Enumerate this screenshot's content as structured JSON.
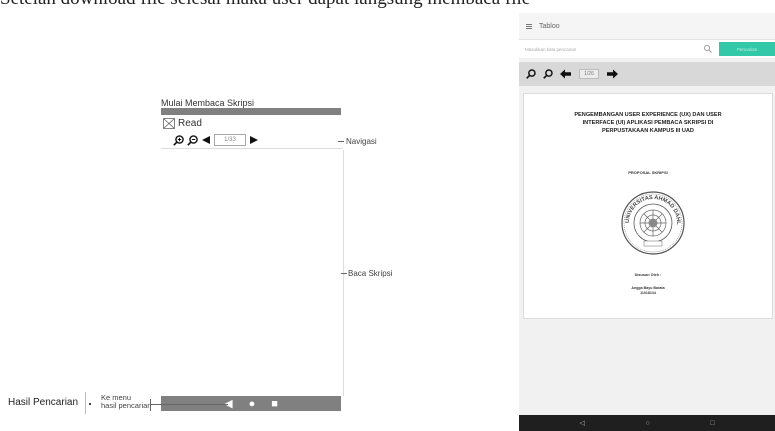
{
  "caption": {
    "text": "Setelah download file selesai maka user dapat langsung membaca file"
  },
  "wireframe": {
    "title": "Mulai Membaca Skripsi",
    "read_label": "Read",
    "page_indicator": "1/33",
    "nav_annotation": "Navigasi",
    "body_annotation": "Baca Skripsi",
    "bottom_nav": {
      "back": "◀",
      "home": "●",
      "recent": "■"
    }
  },
  "flow": {
    "left_label": "Hasil Pencarian",
    "link_label_line1": "Ke menu",
    "link_label_line2": "hasil pencarian"
  },
  "app": {
    "title": "Tabloo",
    "search": {
      "placeholder": "Masukkan kata pencarian",
      "button_label": "Pencarian"
    },
    "toolbar": {
      "page_indicator": "1/26"
    },
    "document": {
      "title_line1": "PENGEMBANGAN USER EXPERIENCE (UX) DAN USER",
      "title_line2": "INTERFACE (UI) APLIKASI PEMBACA SKRIPSI DI",
      "title_line3": "PERPUSTAKAAN KAMPUS III UAD",
      "proposal": "PROPOSAL SKRIPSI",
      "seal_text": "UNIVERSITAS AHMAD DAHLAN",
      "disusun": "Disusun Oleh :",
      "author": "Angga Bayu Barata",
      "nim": "11018134"
    },
    "navbar": {
      "back": "◁",
      "home": "○",
      "recent": "□"
    }
  },
  "colors": {
    "accent": "#33c9a8",
    "wire_gray": "#808080",
    "navbar": "#1f1f1f"
  }
}
